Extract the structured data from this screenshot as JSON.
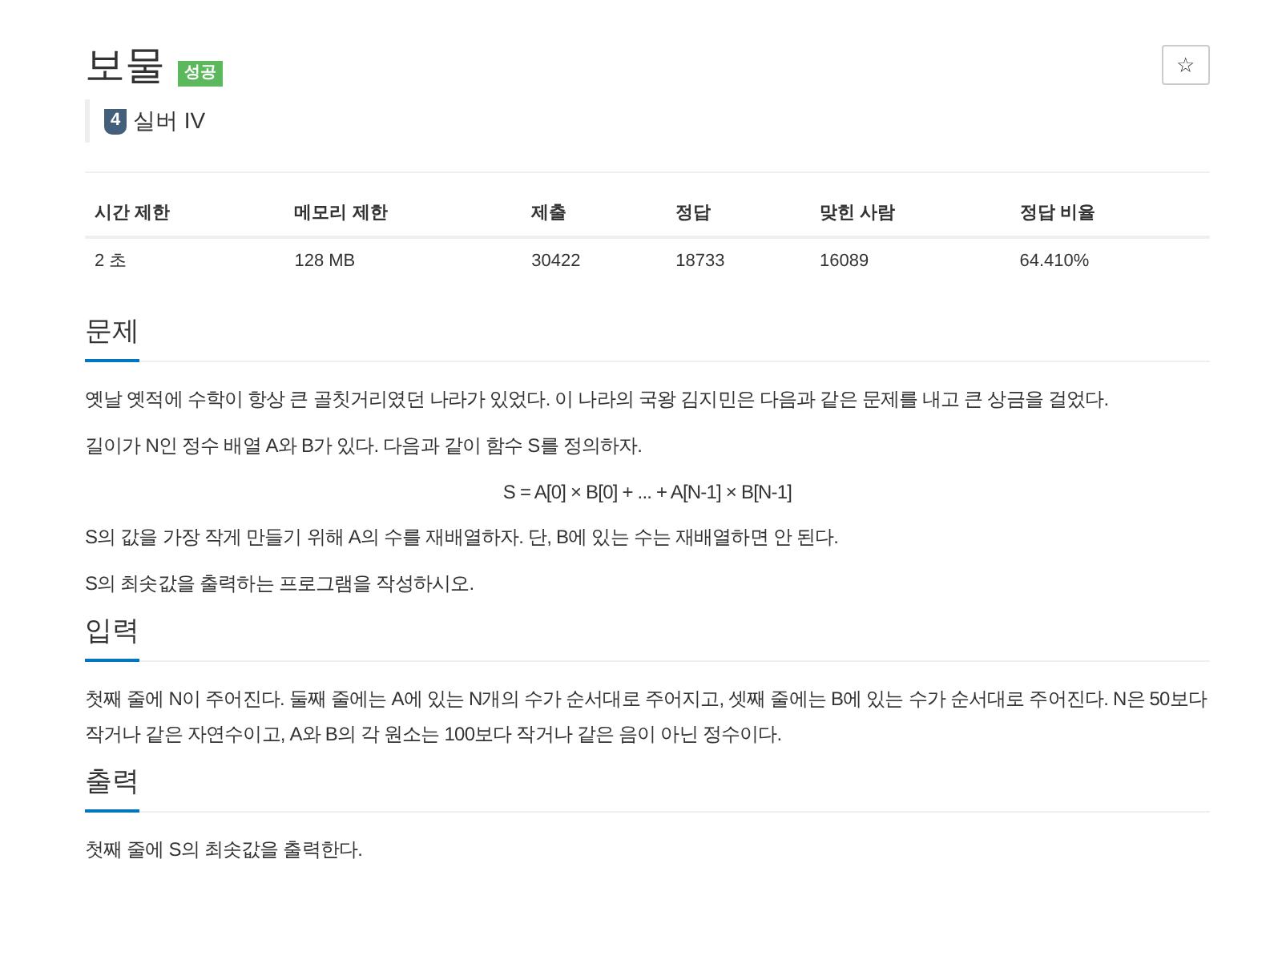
{
  "problem": {
    "title": "보물",
    "result_badge": "성공",
    "tier": {
      "number": "4",
      "label": "실버 IV"
    },
    "star_button": "☆"
  },
  "stats": {
    "columns": [
      "시간 제한",
      "메모리 제한",
      "제출",
      "정답",
      "맞힌 사람",
      "정답 비율"
    ],
    "row": [
      "2 초",
      "128 MB",
      "30422",
      "18733",
      "16089",
      "64.410%"
    ]
  },
  "sections": [
    {
      "heading": "문제",
      "paragraphs": [
        {
          "kind": "text",
          "text": "옛날 옛적에 수학이 항상 큰 골칫거리였던 나라가 있었다. 이 나라의 국왕 김지민은 다음과 같은 문제를 내고 큰 상금을 걸었다."
        },
        {
          "kind": "text",
          "text": "길이가 N인 정수 배열 A와 B가 있다. 다음과 같이 함수 S를 정의하자."
        },
        {
          "kind": "formula",
          "text": "S = A[0] × B[0] + ... + A[N-1] × B[N-1]"
        },
        {
          "kind": "text",
          "text": "S의 값을 가장 작게 만들기 위해 A의 수를 재배열하자. 단, B에 있는 수는 재배열하면 안 된다."
        },
        {
          "kind": "text",
          "text": "S의 최솟값을 출력하는 프로그램을 작성하시오."
        }
      ]
    },
    {
      "heading": "입력",
      "paragraphs": [
        {
          "kind": "text",
          "text": "첫째 줄에 N이 주어진다. 둘째 줄에는 A에 있는 N개의 수가 순서대로 주어지고, 셋째 줄에는 B에 있는 수가 순서대로 주어진다. N은 50보다 작거나 같은 자연수이고, A와 B의 각 원소는 100보다 작거나 같은 음이 아닌 정수이다."
        }
      ]
    },
    {
      "heading": "출력",
      "paragraphs": [
        {
          "kind": "text",
          "text": "첫째 줄에 S의 최솟값을 출력한다."
        }
      ]
    }
  ]
}
